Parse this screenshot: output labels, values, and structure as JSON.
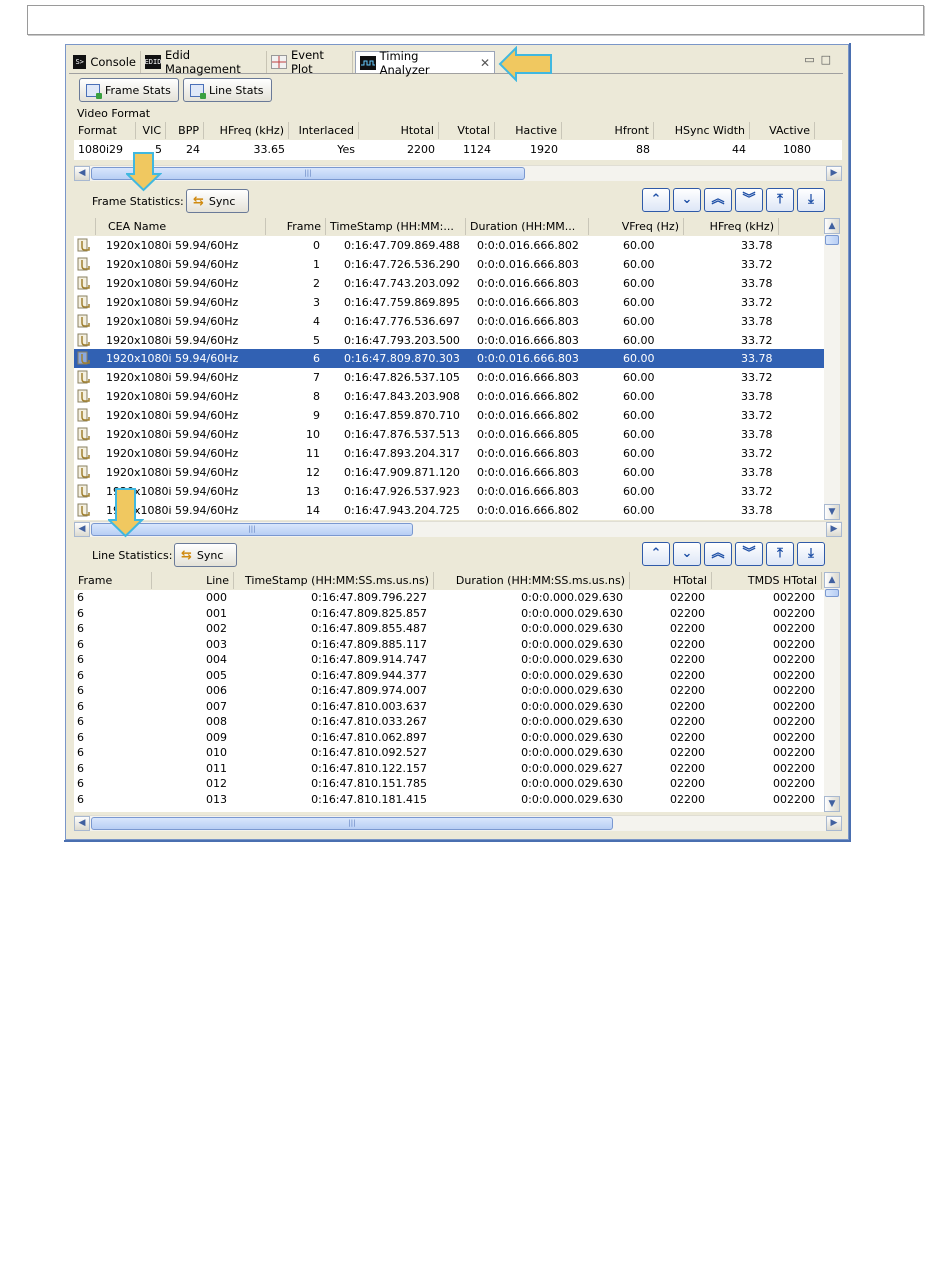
{
  "tabs": [
    {
      "label": "Console",
      "icon": "console-icon"
    },
    {
      "label": "Edid Management",
      "icon": "edid-icon"
    },
    {
      "label": "Event Plot",
      "icon": "event-plot-icon"
    },
    {
      "label": "Timing Analyzer",
      "icon": "timing-analyzer-icon",
      "active": true
    }
  ],
  "toolbar": {
    "frame_stats": "Frame Stats",
    "line_stats": "Line Stats"
  },
  "video_format": {
    "label": "Video Format",
    "columns": [
      "Format",
      "VIC",
      "BPP",
      "HFreq (kHz)",
      "Interlaced",
      "Htotal",
      "Vtotal",
      "Hactive",
      "Hfront",
      "HSync Width",
      "VActive"
    ],
    "values": [
      "1080i29",
      "5",
      "24",
      "33.65",
      "Yes",
      "2200",
      "1124",
      "1920",
      "88",
      "44",
      "1080"
    ]
  },
  "frame_stats": {
    "label": "Frame Statistics:",
    "sync_label": "Sync",
    "columns": [
      "CEA Name",
      "Frame",
      "TimeStamp (HH:MM:...",
      "Duration (HH:MM...",
      "VFreq (Hz)",
      "HFreq (kHz)"
    ],
    "selected_index": 6,
    "rows": [
      [
        "1920x1080i 59.94/60Hz",
        "0",
        "0:16:47.709.869.488",
        "0:0:0.016.666.802",
        "60.00",
        "33.78"
      ],
      [
        "1920x1080i 59.94/60Hz",
        "1",
        "0:16:47.726.536.290",
        "0:0:0.016.666.803",
        "60.00",
        "33.72"
      ],
      [
        "1920x1080i 59.94/60Hz",
        "2",
        "0:16:47.743.203.092",
        "0:0:0.016.666.803",
        "60.00",
        "33.78"
      ],
      [
        "1920x1080i 59.94/60Hz",
        "3",
        "0:16:47.759.869.895",
        "0:0:0.016.666.803",
        "60.00",
        "33.72"
      ],
      [
        "1920x1080i 59.94/60Hz",
        "4",
        "0:16:47.776.536.697",
        "0:0:0.016.666.803",
        "60.00",
        "33.78"
      ],
      [
        "1920x1080i 59.94/60Hz",
        "5",
        "0:16:47.793.203.500",
        "0:0:0.016.666.803",
        "60.00",
        "33.72"
      ],
      [
        "1920x1080i 59.94/60Hz",
        "6",
        "0:16:47.809.870.303",
        "0:0:0.016.666.803",
        "60.00",
        "33.78"
      ],
      [
        "1920x1080i 59.94/60Hz",
        "7",
        "0:16:47.826.537.105",
        "0:0:0.016.666.803",
        "60.00",
        "33.72"
      ],
      [
        "1920x1080i 59.94/60Hz",
        "8",
        "0:16:47.843.203.908",
        "0:0:0.016.666.802",
        "60.00",
        "33.78"
      ],
      [
        "1920x1080i 59.94/60Hz",
        "9",
        "0:16:47.859.870.710",
        "0:0:0.016.666.802",
        "60.00",
        "33.72"
      ],
      [
        "1920x1080i 59.94/60Hz",
        "10",
        "0:16:47.876.537.513",
        "0:0:0.016.666.805",
        "60.00",
        "33.78"
      ],
      [
        "1920x1080i 59.94/60Hz",
        "11",
        "0:16:47.893.204.317",
        "0:0:0.016.666.803",
        "60.00",
        "33.72"
      ],
      [
        "1920x1080i 59.94/60Hz",
        "12",
        "0:16:47.909.871.120",
        "0:0:0.016.666.803",
        "60.00",
        "33.78"
      ],
      [
        "1920x1080i 59.94/60Hz",
        "13",
        "0:16:47.926.537.923",
        "0:0:0.016.666.803",
        "60.00",
        "33.72"
      ],
      [
        "1920x1080i 59.94/60Hz",
        "14",
        "0:16:47.943.204.725",
        "0:0:0.016.666.802",
        "60.00",
        "33.78"
      ]
    ]
  },
  "line_stats": {
    "label": "Line Statistics:",
    "sync_label": "Sync",
    "columns": [
      "Frame",
      "Line",
      "TimeStamp (HH:MM:SS.ms.us.ns)",
      "Duration (HH:MM:SS.ms.us.ns)",
      "HTotal",
      "TMDS HTotal"
    ],
    "rows": [
      [
        "6",
        "000",
        "0:16:47.809.796.227",
        "0:0:0.000.029.630",
        "02200",
        "002200"
      ],
      [
        "6",
        "001",
        "0:16:47.809.825.857",
        "0:0:0.000.029.630",
        "02200",
        "002200"
      ],
      [
        "6",
        "002",
        "0:16:47.809.855.487",
        "0:0:0.000.029.630",
        "02200",
        "002200"
      ],
      [
        "6",
        "003",
        "0:16:47.809.885.117",
        "0:0:0.000.029.630",
        "02200",
        "002200"
      ],
      [
        "6",
        "004",
        "0:16:47.809.914.747",
        "0:0:0.000.029.630",
        "02200",
        "002200"
      ],
      [
        "6",
        "005",
        "0:16:47.809.944.377",
        "0:0:0.000.029.630",
        "02200",
        "002200"
      ],
      [
        "6",
        "006",
        "0:16:47.809.974.007",
        "0:0:0.000.029.630",
        "02200",
        "002200"
      ],
      [
        "6",
        "007",
        "0:16:47.810.003.637",
        "0:0:0.000.029.630",
        "02200",
        "002200"
      ],
      [
        "6",
        "008",
        "0:16:47.810.033.267",
        "0:0:0.000.029.630",
        "02200",
        "002200"
      ],
      [
        "6",
        "009",
        "0:16:47.810.062.897",
        "0:0:0.000.029.630",
        "02200",
        "002200"
      ],
      [
        "6",
        "010",
        "0:16:47.810.092.527",
        "0:0:0.000.029.630",
        "02200",
        "002200"
      ],
      [
        "6",
        "011",
        "0:16:47.810.122.157",
        "0:0:0.000.029.627",
        "02200",
        "002200"
      ],
      [
        "6",
        "012",
        "0:16:47.810.151.785",
        "0:0:0.000.029.630",
        "02200",
        "002200"
      ],
      [
        "6",
        "013",
        "0:16:47.810.181.415",
        "0:0:0.000.029.630",
        "02200",
        "002200"
      ]
    ]
  },
  "nav_buttons": [
    "up-icon",
    "down-icon",
    "page-up-icon",
    "page-down-icon",
    "first-icon",
    "last-icon"
  ],
  "colors": {
    "selection": "#3161b3",
    "accent_arrow": "#f0c040",
    "arrow_outline": "#40b8e0"
  }
}
